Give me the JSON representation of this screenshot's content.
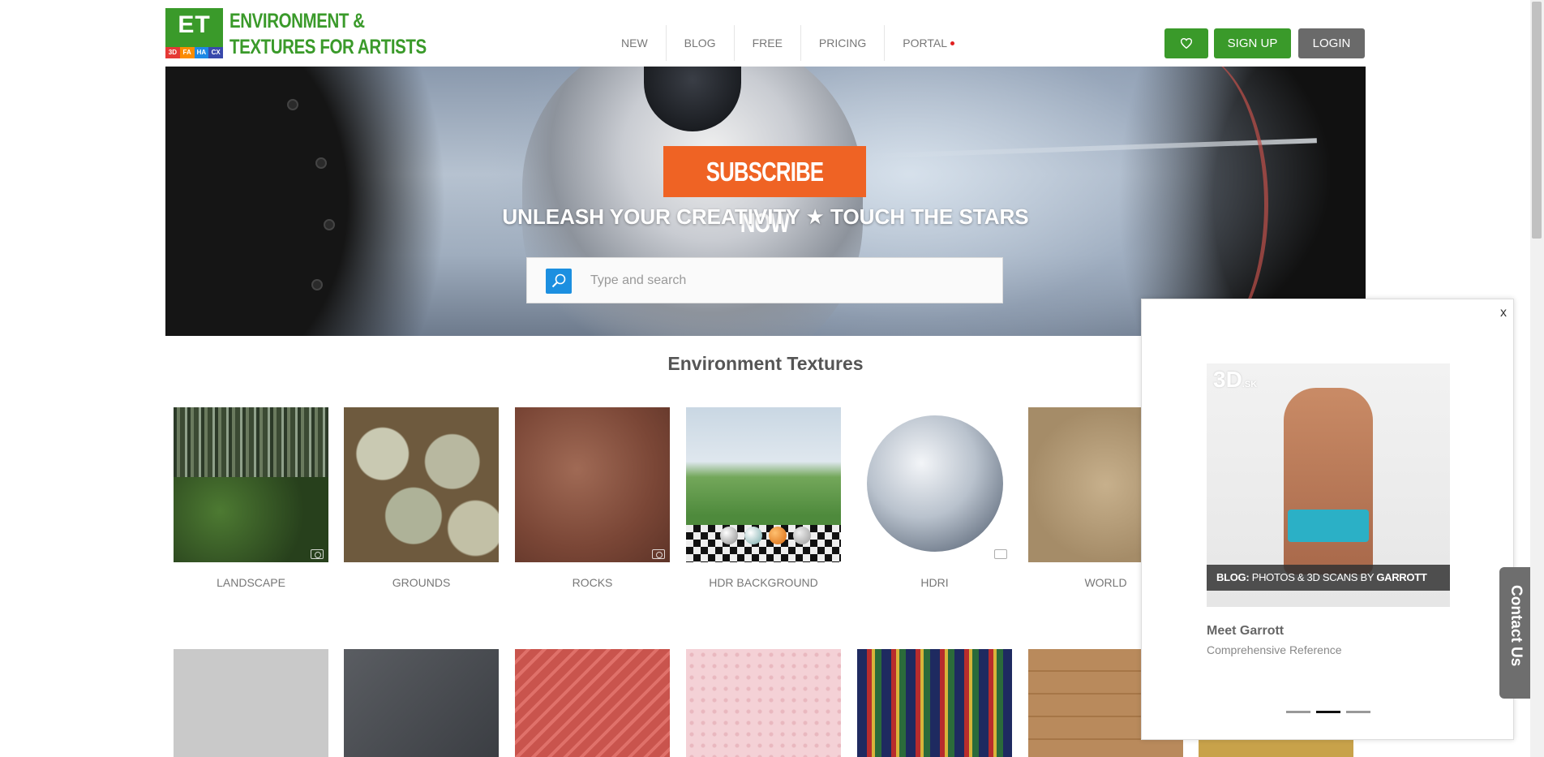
{
  "logo": {
    "initials": "ET",
    "tags": [
      "3D",
      "FA",
      "HA",
      "CX"
    ],
    "tag_colors": [
      "#e53935",
      "#fb8c00",
      "#1e88e5",
      "#3949ab"
    ],
    "title_line1": "ENVIRONMENT &",
    "title_line2": "TEXTURES FOR ARTISTS",
    "brand_color": "#3a9a2a"
  },
  "nav": {
    "items": [
      "NEW",
      "BLOG",
      "FREE",
      "PRICING",
      "PORTAL"
    ]
  },
  "header_buttons": {
    "favorites_icon": "heart-icon",
    "signup": "SIGN UP",
    "login": "LOGIN"
  },
  "hero": {
    "subscribe": "SUBSCRIBE NOW",
    "tagline": "UNLEASH YOUR CREATIVITY ★ TOUCH THE STARS",
    "search_placeholder": "Type and search",
    "accent_color": "#ef6324"
  },
  "section": {
    "title": "Environment Textures",
    "categories": [
      "LANDSCAPE",
      "GROUNDS",
      "ROCKS",
      "HDR BACKGROUND",
      "HDRI",
      "WORLD"
    ]
  },
  "popup": {
    "close": "x",
    "brand": "3D",
    "brand_suffix": ".SK",
    "caption_prefix": "BLOG:",
    "caption_text": "PHOTOS & 3D SCANS BY",
    "caption_name": "GARROTT",
    "title": "Meet Garrott",
    "subtitle": "Comprehensive Reference"
  },
  "contact": "Contact Us"
}
